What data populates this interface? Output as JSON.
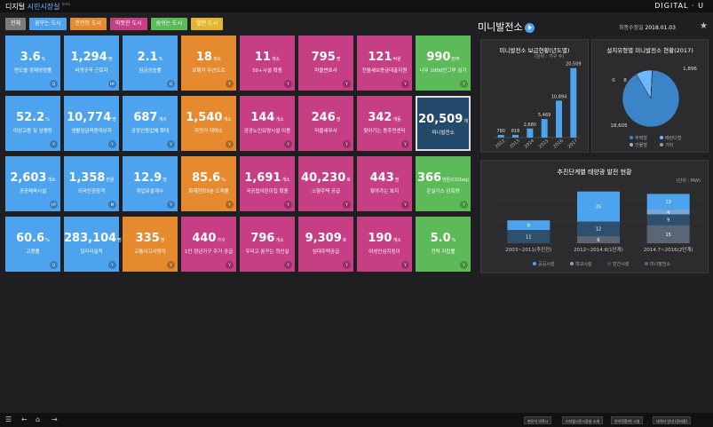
{
  "app": {
    "title_main": "디지털 ",
    "title_highlight": "시민시장실",
    "title_sub": "beta",
    "brand": "DIGITAL · U"
  },
  "tabs": [
    {
      "label": "전체",
      "color": "#7b7b7b"
    },
    {
      "label": "꿈꾸는 도시",
      "color": "#4da3ee"
    },
    {
      "label": "안전한 도시",
      "color": "#e58a2f"
    },
    {
      "label": "따뜻한 도시",
      "color": "#c63e83"
    },
    {
      "label": "숨쉬는 도시",
      "color": "#5cba58"
    },
    {
      "label": "열린 도시",
      "color": "#e3b62d"
    }
  ],
  "tiles": [
    [
      {
        "value": "3.6",
        "unit": "%",
        "label": "연도별 경제성장률",
        "badge": "Q",
        "color": "blue"
      },
      {
        "value": "1,294",
        "unit": "명",
        "label": "비정규직 근로자",
        "badge": "HY",
        "color": "blue"
      },
      {
        "value": "2.1",
        "unit": "%",
        "label": "임금상승률",
        "badge": "Q",
        "color": "blue"
      },
      {
        "value": "18",
        "unit": "개소",
        "label": "보행자 우선도로",
        "badge": "Y",
        "color": "orange"
      },
      {
        "value": "11",
        "unit": "개소",
        "label": "50+시설 확충",
        "badge": "Y",
        "color": "pink"
      },
      {
        "value": "795",
        "unit": "명",
        "label": "마을변호사",
        "badge": "Y",
        "color": "pink"
      },
      {
        "value": "121",
        "unit": "억원",
        "label": "전월세보증금대출지원",
        "badge": "Y",
        "color": "pink"
      },
      {
        "value": "990",
        "unit": "만주",
        "label": "나무 1000만그루 심기",
        "badge": "Y",
        "color": "green"
      }
    ],
    [
      {
        "value": "52.2",
        "unit": "%",
        "label": "여성고용 및 성평등",
        "badge": "Y",
        "color": "blue"
      },
      {
        "value": "10,774",
        "unit": "명",
        "label": "생활임금적용대상자",
        "badge": "Y",
        "color": "blue"
      },
      {
        "value": "687",
        "unit": "개사",
        "label": "공정인증업체 확대",
        "badge": "Y",
        "color": "blue"
      },
      {
        "value": "1,540",
        "unit": "개소",
        "label": "자전거 대여소",
        "badge": "Y",
        "color": "orange"
      },
      {
        "value": "144",
        "unit": "개소",
        "label": "공공노인요양시설 이용",
        "badge": "Y",
        "color": "pink"
      },
      {
        "value": "246",
        "unit": "명",
        "label": "마을세무사",
        "badge": "Y",
        "color": "pink"
      },
      {
        "value": "342",
        "unit": "개동",
        "label": "찾아가는 동주민센터",
        "badge": "Y",
        "color": "pink"
      },
      {
        "value": "20,509",
        "unit": "개",
        "label": "미니발전소",
        "badge": "",
        "color": "navy"
      }
    ],
    [
      {
        "value": "2,603",
        "unit": "개소",
        "label": "공공체육시설",
        "badge": "HY",
        "color": "blue"
      },
      {
        "value": "1,358",
        "unit": "만원",
        "label": "외국인관광객",
        "badge": "M",
        "color": "blue"
      },
      {
        "value": "12.9",
        "unit": "명",
        "label": "취업유발계수",
        "badge": "Y",
        "color": "blue"
      },
      {
        "value": "85.6",
        "unit": "%",
        "label": "화재현장5분 도착률",
        "badge": "Y",
        "color": "orange"
      },
      {
        "value": "1,691",
        "unit": "개소",
        "label": "국공립어린이집 확충",
        "badge": "Y",
        "color": "pink"
      },
      {
        "value": "40,230",
        "unit": "호",
        "label": "소형주택 공급",
        "badge": "Y",
        "color": "pink"
      },
      {
        "value": "443",
        "unit": "명",
        "label": "찾아가는 복지",
        "badge": "Y",
        "color": "pink"
      },
      {
        "value": "366",
        "unit": "만톤(CO2eq)",
        "label": "온실가스 감축량",
        "badge": "Y",
        "color": "green"
      }
    ],
    [
      {
        "value": "60.6",
        "unit": "%",
        "label": "고용률",
        "badge": "Q",
        "color": "blue"
      },
      {
        "value": "283,104",
        "unit": "명",
        "label": "일자리실적",
        "badge": "Y",
        "color": "blue"
      },
      {
        "value": "335",
        "unit": "명",
        "label": "교통사고사망자",
        "badge": "Y",
        "color": "orange"
      },
      {
        "value": "440",
        "unit": "가구",
        "label": "1인 청년가구 주거 공급",
        "badge": "Y",
        "color": "pink"
      },
      {
        "value": "796",
        "unit": "개소",
        "label": "우리고 꿈꾸는 혁신실",
        "badge": "Y",
        "color": "pink"
      },
      {
        "value": "9,309",
        "unit": "호",
        "label": "임대주택공급",
        "badge": "Y",
        "color": "pink"
      },
      {
        "value": "190",
        "unit": "개소",
        "label": "여성안심지킴이",
        "badge": "Y",
        "color": "pink"
      },
      {
        "value": "5.0",
        "unit": "%",
        "label": "전력 자립률",
        "badge": "Y",
        "color": "green"
      }
    ]
  ],
  "mini": {
    "title": "미니발전소",
    "date_label": "최종수정일",
    "date": "2018.01.03"
  },
  "chart_data": [
    {
      "type": "bar",
      "title": "미니발전소 보급현황(년도별)",
      "unit_label": "(단위 : 가구 수)",
      "categories": [
        "2012",
        "2013",
        "2014",
        "2015",
        "2016",
        "2017"
      ],
      "values": [
        780,
        818,
        2680,
        5469,
        10894,
        20509
      ],
      "ylim": [
        0,
        22000
      ],
      "color": "#4da3ee"
    },
    {
      "type": "pie",
      "title": "설치유형별 미니발전소 현황(2017)",
      "slices": [
        {
          "name": "주택형",
          "value": 18605,
          "color": "#3b84c7"
        },
        {
          "name": "베란다형",
          "value": 1896,
          "color": "#6fb7ff"
        },
        {
          "name": "건물형",
          "value": 8,
          "color": "#8fb8d8"
        },
        {
          "name": "기타",
          "value": 0,
          "color": "#9a9a9a"
        }
      ],
      "labels": [
        "0",
        "8",
        "1,896",
        "18,605"
      ]
    },
    {
      "type": "bar",
      "title": "추진단계별 태양광 발전 현황",
      "unit_label": "(단위 : MW)",
      "stacked": true,
      "categories": [
        "2003~2011(추진전)",
        "2012~2014.6(1단계)",
        "2014.7~2016(2단계)"
      ],
      "series": [
        {
          "name": "공공시설",
          "values": [
            8,
            25,
            13
          ],
          "color": "#4da3ee"
        },
        {
          "name": "학교시설",
          "values": [
            0,
            0,
            4
          ],
          "color": "#7aa7d4"
        },
        {
          "name": "민간시설",
          "values": [
            11,
            12,
            9
          ],
          "color": "#2f4f6f"
        },
        {
          "name": "미니발전소",
          "values": [
            0,
            6,
            15
          ],
          "color": "#5a6675"
        }
      ],
      "ylim": [
        0,
        45
      ]
    }
  ],
  "bottom": {
    "selects": [
      "현유석 의혹시",
      "디지털시민시장실 소개",
      "언어전환/현 시설",
      "데이터 안내 (준비중)"
    ]
  }
}
